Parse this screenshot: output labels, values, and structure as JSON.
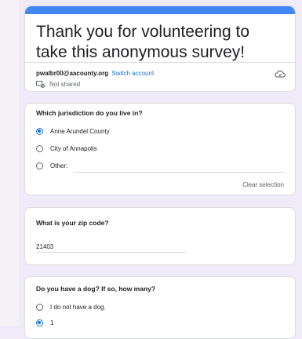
{
  "form": {
    "title": "Thank you for volunteering to take this anonymous survey!",
    "account_email": "pwalbr00@aacounty.org",
    "switch_account": "Switch account",
    "shared_status": "Not shared",
    "accent_color": "#4285f4"
  },
  "questions": [
    {
      "title": "Which jurisdiction do you live in?",
      "options": [
        {
          "label": "Anne Arundel County",
          "checked": true
        },
        {
          "label": "City of Annapolis",
          "checked": false
        },
        {
          "label": "Other:",
          "checked": false
        }
      ],
      "clear_label": "Clear selection"
    },
    {
      "title": "What is your zip code?",
      "answer": "21403"
    },
    {
      "title": "Do you have a dog? If so, how many?",
      "options": [
        {
          "label": "I do not have a dog.",
          "checked": false
        },
        {
          "label": "1",
          "checked": true
        }
      ]
    }
  ],
  "icons": {
    "cloud": "cloud-save-icon",
    "not_shared": "not-shared-icon"
  }
}
